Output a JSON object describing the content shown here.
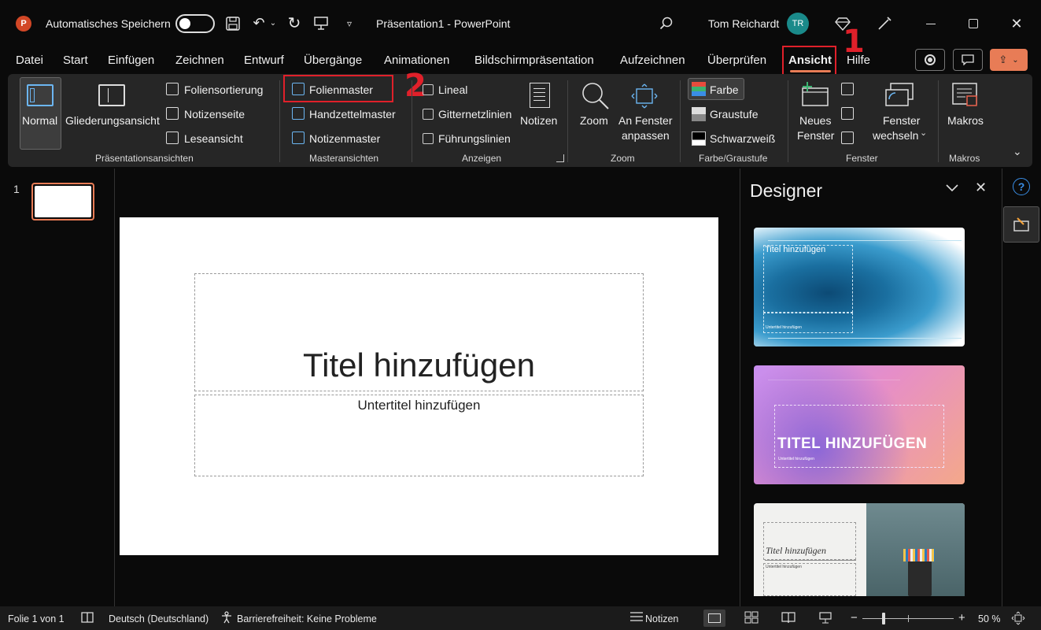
{
  "titlebar": {
    "autosave_label": "Automatisches Speichern",
    "doc_title": "Präsentation1  -  PowerPoint",
    "user_name": "Tom Reichardt",
    "user_initials": "TR"
  },
  "menu": {
    "tabs": [
      "Datei",
      "Start",
      "Einfügen",
      "Zeichnen",
      "Entwurf",
      "Übergänge",
      "Animationen",
      "Bildschirmpräsentation",
      "Aufzeichnen",
      "Überprüfen",
      "Ansicht",
      "Hilfe"
    ],
    "active_tab": "Ansicht"
  },
  "annotations": {
    "step1": "1",
    "step2": "2"
  },
  "ribbon": {
    "presentation_views": {
      "normal": "Normal",
      "outline": "Gliederungsansicht",
      "slide_sorter": "Foliensortierung",
      "notes_page": "Notizenseite",
      "reading_view": "Leseansicht",
      "group_label": "Präsentationsansichten"
    },
    "master_views": {
      "slide_master": "Folienmaster",
      "handout_master": "Handzettelmaster",
      "notes_master": "Notizenmaster",
      "group_label": "Masteransichten"
    },
    "show": {
      "ruler": "Lineal",
      "gridlines": "Gitternetzlinien",
      "guides": "Führungslinien",
      "notes": "Notizen",
      "group_label": "Anzeigen"
    },
    "zoom": {
      "zoom": "Zoom",
      "fit_window_1": "An Fenster",
      "fit_window_2": "anpassen",
      "group_label": "Zoom"
    },
    "color": {
      "color": "Farbe",
      "grayscale": "Graustufe",
      "bw": "Schwarzweiß",
      "group_label": "Farbe/Graustufe"
    },
    "window": {
      "new_window_1": "Neues",
      "new_window_2": "Fenster",
      "switch_1": "Fenster",
      "switch_2": "wechseln",
      "group_label": "Fenster"
    },
    "macros": {
      "macros": "Makros",
      "group_label": "Makros"
    }
  },
  "thumbnails": {
    "slide_number": "1"
  },
  "slide": {
    "title": "Titel hinzufügen",
    "subtitle": "Untertitel hinzufügen"
  },
  "designer": {
    "title": "Designer",
    "card1_title": "Titel hinzufügen",
    "card1_subtitle": "Untertitel hinzufügen",
    "card2_title": "TITEL HINZUFÜGEN",
    "card2_subtitle": "Untertitel hinzufügen",
    "card3_title": "Titel hinzufügen",
    "card3_subtitle": "Untertitel hinzufügen"
  },
  "statusbar": {
    "slide_info": "Folie 1 von 1",
    "language": "Deutsch (Deutschland)",
    "accessibility": "Barrierefreiheit: Keine Probleme",
    "notes": "Notizen",
    "zoom_level": "50 %",
    "zoom_minus": "−",
    "zoom_plus": "+"
  },
  "colors": {
    "accent": "#e87c56",
    "annotation_red": "#e0202a",
    "avatar": "#1a8a8a",
    "ribbon_bg": "#262626"
  }
}
